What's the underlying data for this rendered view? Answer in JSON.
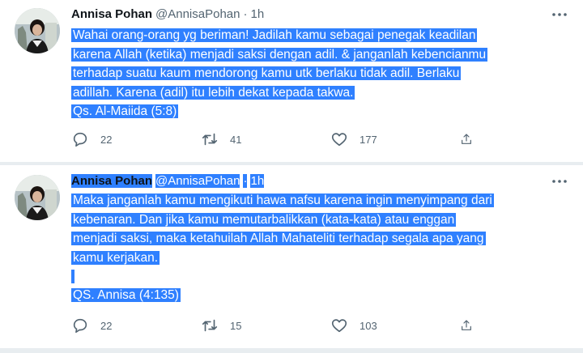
{
  "tweets": [
    {
      "author": {
        "name": "Annisa Pohan",
        "handle": "@AnnisaPohan",
        "separator": "·",
        "time": "1h"
      },
      "lines": [
        "Wahai orang-orang yg beriman! Jadilah kamu sebagai penegak keadilan",
        "karena Allah (ketika) menjadi saksi dengan adil. & janganlah kebencianmu",
        "terhadap suatu kaum mendorong kamu utk berlaku tidak adil. Berlaku",
        "adillah. Karena (adil) itu lebih dekat kepada takwa.",
        "Qs. Al-Maiida (5:8)"
      ],
      "stats": {
        "replies": "22",
        "retweets": "41",
        "likes": "177"
      }
    },
    {
      "author": {
        "name": "Annisa Pohan",
        "handle": "@AnnisaPohan",
        "separator": "·",
        "time": "1h"
      },
      "lines": [
        "Maka janganlah kamu mengikuti hawa nafsu karena ingin menyimpang dari",
        "kebenaran. Dan jika kamu memutarbalikkan (kata-kata) atau enggan",
        "menjadi saksi, maka ketahuilah Allah Mahateliti terhadap segala apa yang",
        "kamu kerjakan.",
        "",
        "QS. Annisa (4:135)"
      ],
      "stats": {
        "replies": "22",
        "retweets": "15",
        "likes": "103"
      }
    }
  ],
  "icons": {
    "reply": "reply-icon",
    "retweet": "retweet-icon",
    "like": "heart-icon",
    "share": "share-icon",
    "more": "more-icon"
  },
  "colors": {
    "highlight": "#2f80ff",
    "muted": "#536471",
    "divider": "#e8edf0"
  }
}
